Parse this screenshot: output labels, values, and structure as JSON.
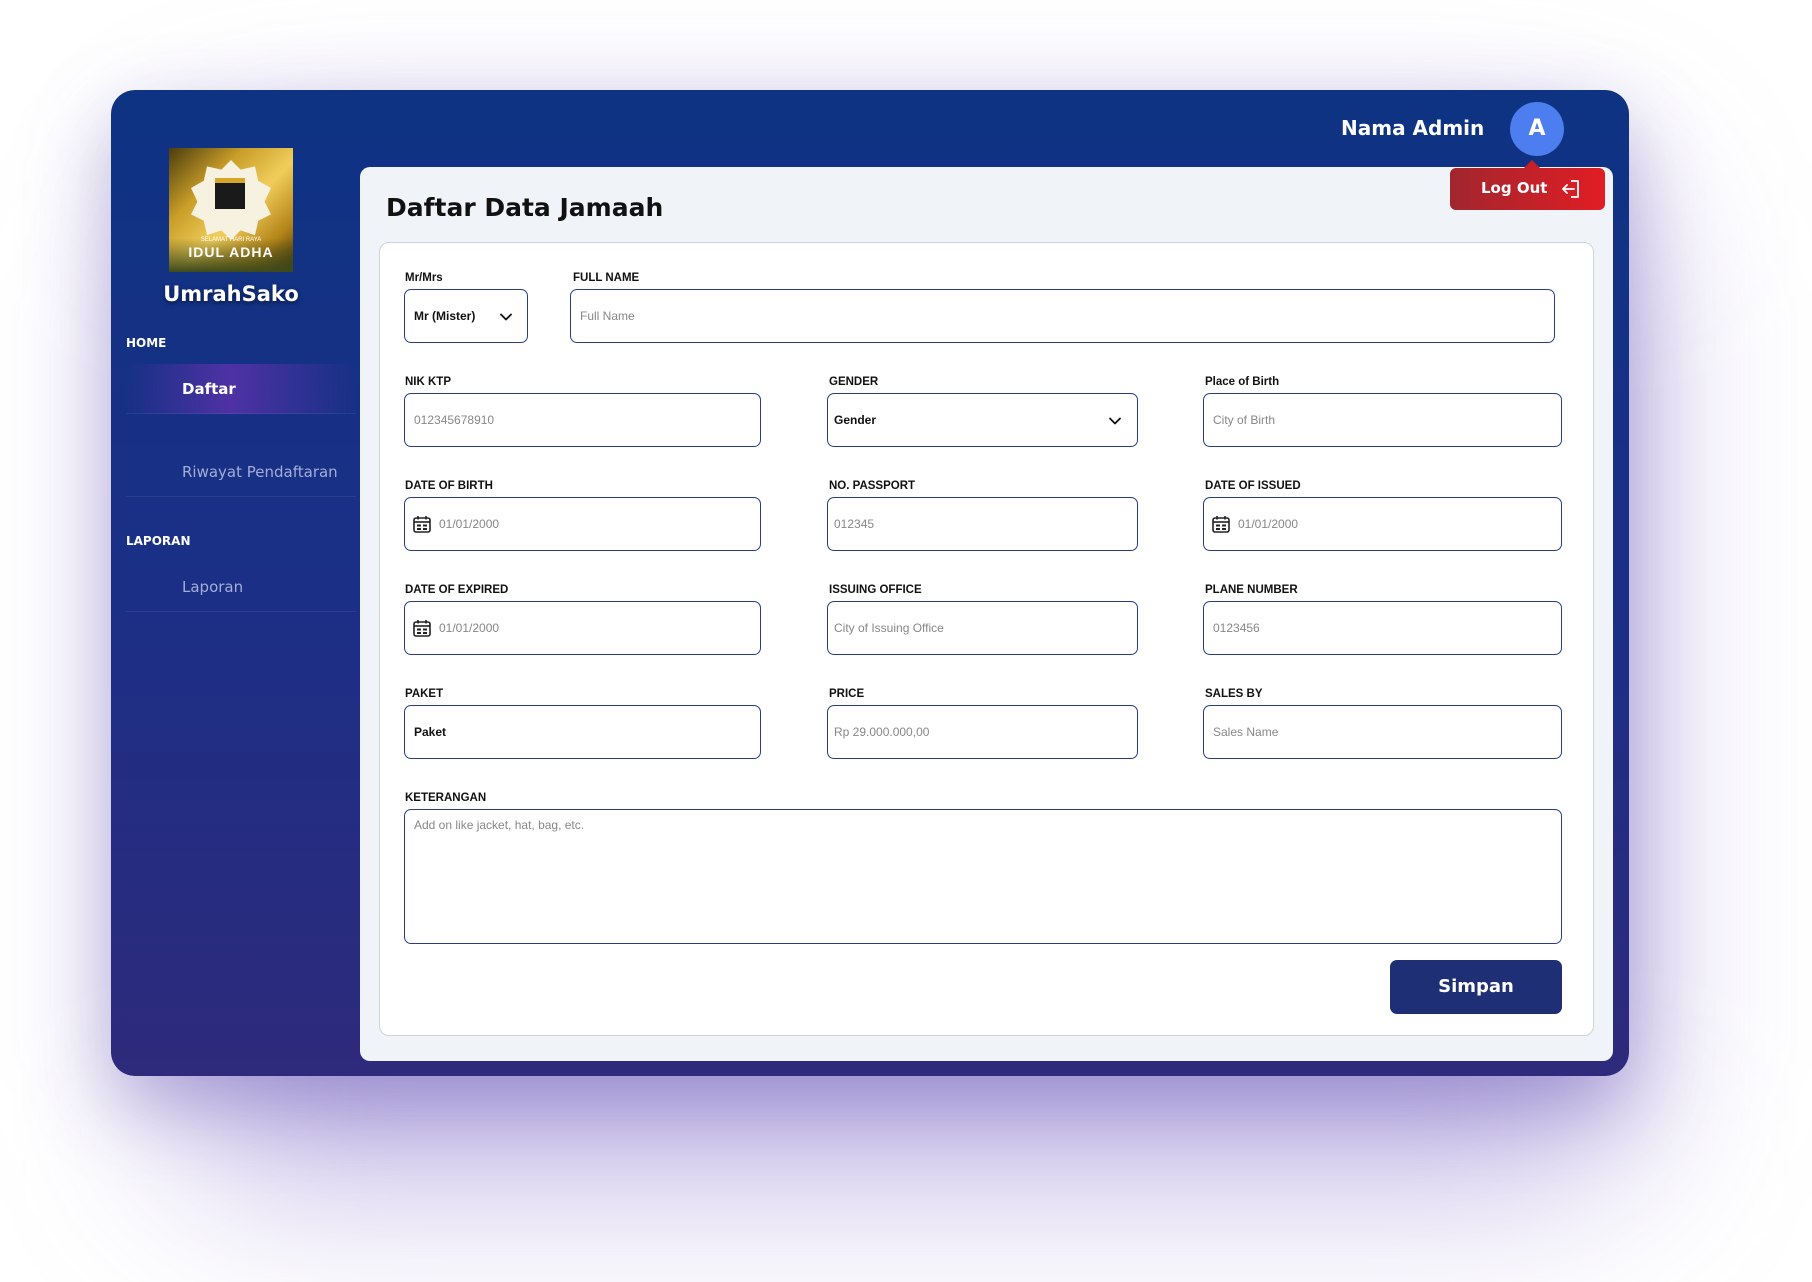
{
  "topbar": {
    "admin_name": "Nama Admin",
    "avatar_initial": "A",
    "logout_label": "Log Out"
  },
  "sidebar": {
    "logo": {
      "headline": "IDUL ADHA",
      "subline": "SELAMAT HARI RAYA"
    },
    "brand": "UmrahSako",
    "sections": [
      {
        "label": "HOME",
        "items": [
          {
            "label": "Daftar",
            "active": true
          },
          {
            "label": "Riwayat Pendaftaran",
            "active": false
          }
        ]
      },
      {
        "label": "LAPORAN",
        "items": [
          {
            "label": "Laporan",
            "active": false
          }
        ]
      }
    ]
  },
  "page": {
    "title": "Daftar Data Jamaah"
  },
  "form": {
    "title_select": {
      "label": "Mr/Mrs",
      "value": "Mr (Mister)"
    },
    "full_name": {
      "label": "FULL NAME",
      "placeholder": "Full Name"
    },
    "nik": {
      "label": "NIK KTP",
      "placeholder": "012345678910"
    },
    "gender": {
      "label": "GENDER",
      "value": "Gender"
    },
    "place_of_birth": {
      "label": "Place of Birth",
      "placeholder": "City of Birth"
    },
    "date_of_birth": {
      "label": "DATE OF BIRTH",
      "placeholder": "01/01/2000"
    },
    "passport": {
      "label": "NO. PASSPORT",
      "placeholder": "012345"
    },
    "date_issued": {
      "label": "DATE OF ISSUED",
      "placeholder": "01/01/2000"
    },
    "date_expired": {
      "label": "DATE OF EXPIRED",
      "placeholder": "01/01/2000"
    },
    "issuing_office": {
      "label": "ISSUING OFFICE",
      "placeholder": "City of Issuing Office"
    },
    "plane_number": {
      "label": "PLANE NUMBER",
      "placeholder": "0123456"
    },
    "paket": {
      "label": "PAKET",
      "value": "Paket"
    },
    "price": {
      "label": "PRICE",
      "placeholder": "Rp 29.000.000,00"
    },
    "sales_by": {
      "label": "SALES BY",
      "placeholder": "Sales Name"
    },
    "keterangan": {
      "label": "KETERANGAN",
      "placeholder": "Add on like jacket, hat, bag, etc."
    },
    "submit_label": "Simpan"
  },
  "colors": {
    "primary": "#1e2f75",
    "sidebar_bg": "#0e3383",
    "logout": "#e11d24",
    "avatar": "#4d7ef0",
    "field_border": "#283c8c"
  }
}
